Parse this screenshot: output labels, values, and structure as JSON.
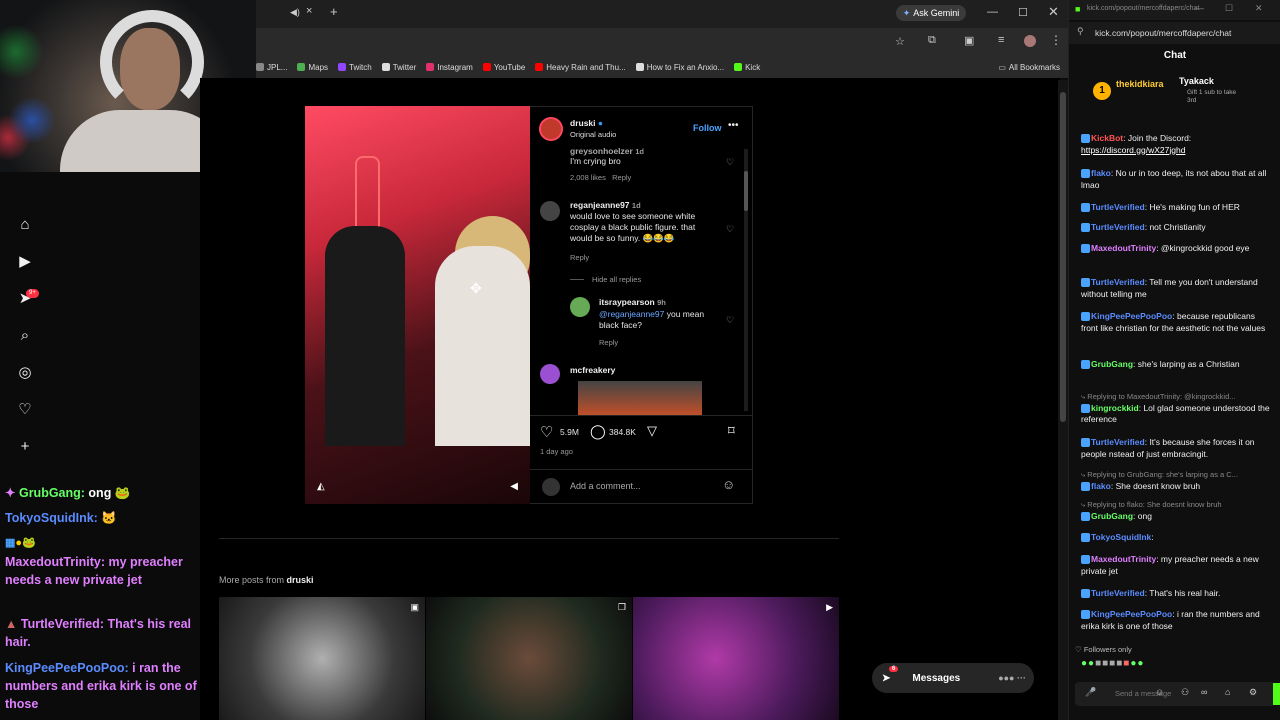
{
  "webcam": {},
  "browser": {
    "tab_icons": {
      "mute": "speaker-icon",
      "close": "×",
      "new": "+"
    },
    "gemini": "Ask Gemini",
    "bookmarks": [
      {
        "label": "JPL...",
        "color": "#888"
      },
      {
        "label": "Maps",
        "color": "#4caf50"
      },
      {
        "label": "Twitch",
        "color": "#9146ff"
      },
      {
        "label": "Twitter",
        "color": "#ddd"
      },
      {
        "label": "Instagram",
        "color": "#e1306c"
      },
      {
        "label": "YouTube",
        "color": "#ff0000"
      },
      {
        "label": "Heavy Rain and Thu...",
        "color": "#ff0000"
      },
      {
        "label": "How to Fix an Anxio...",
        "color": "#ddd"
      },
      {
        "label": "Kick",
        "color": "#53fc18"
      }
    ],
    "all_bookmarks": "All Bookmarks"
  },
  "left_chat": [
    {
      "user": "GrubGang:",
      "msg": "ong",
      "user_color": "#66ff66",
      "msg_color": "#ffffff"
    },
    {
      "user": "TokyoSquidInk:",
      "msg": "",
      "user_color": "#5b8cff",
      "msg_color": "#ffffff"
    },
    {
      "user": "MaxedoutTrinity:",
      "msg": "my preacher needs a new private jet",
      "user_color": "#e07fff",
      "msg_color": "#e07fff"
    },
    {
      "user": "TurtleVerified:",
      "msg": "That's his real hair.",
      "user_color": "#e07fff",
      "msg_color": "#e07fff"
    },
    {
      "user": "KingPeePeePooPoo:",
      "msg": "i ran the numbers and erika kirk is one of those",
      "user_color": "#5b8cff",
      "msg_color": "#e07fff"
    }
  ],
  "post": {
    "username": "druski",
    "audio": "Original audio",
    "follow": "Follow",
    "comments": [
      {
        "user": "greysonhoelzer",
        "time": "1d",
        "text": "I'm crying bro",
        "likes": "2,008 likes",
        "reply": "Reply"
      },
      {
        "user": "reganjeanne97",
        "time": "1d",
        "text": "would love to see someone white cosplay a black public figure. that would be so funny. 😂😂😂",
        "reply": "Reply"
      }
    ],
    "hide_replies": "Hide all replies",
    "nested": {
      "user": "itsraypearson",
      "time": "9h",
      "mention": "@reganjeanne97",
      "text": " you mean black face?",
      "reply": "Reply"
    },
    "last_user": "mcfreakery",
    "likes": "5.9M",
    "comment_count": "384.8K",
    "posted": "1 day ago",
    "add_comment": "Add a comment...",
    "more_posts_prefix": "More posts from ",
    "more_posts_user": "druski",
    "messages": "Messages",
    "messages_badge": "6"
  },
  "kick": {
    "url": "kick.com/popout/mercoffdaperc/chat",
    "url_display": "kick.com/popout/mercoffdaperc/chat",
    "title": "Chat",
    "pinned_user1": "thekidkiara",
    "pinned_user2": "Tyakack",
    "pinned_note": "Gift 1 sub to take 3rd",
    "messages": [
      {
        "user": "KickBot",
        "color": "#ff5555",
        "text": "Join the Discord: ",
        "link": "https://discord.gg/wX27jghd"
      },
      {
        "user": "flako",
        "color": "#5b8cff",
        "text": "No ur in too deep, its not abou that at all lmao"
      },
      {
        "user": "TurtleVerified",
        "color": "#5b8cff",
        "text": "He's making fun of HER"
      },
      {
        "user": "TurtleVerified",
        "color": "#5b8cff",
        "text": "not Christianity"
      },
      {
        "user": "MaxedoutTrinity",
        "color": "#e07fff",
        "text": "@kingrockkid good eye"
      },
      {
        "user": "TurtleVerified",
        "color": "#5b8cff",
        "text": "Tell me you don't understand without telling me"
      },
      {
        "user": "KingPeePeePooPoo",
        "color": "#5b8cff",
        "text": "because republicans front like christian for the aesthetic not the values"
      },
      {
        "user": "GrubGang",
        "color": "#66ff66",
        "text": "she's larping as a Christian"
      },
      {
        "reply": "Replying to MaxedoutTrinity: @kingrockkid...",
        "user": "kingrockkid",
        "color": "#66ff66",
        "text": "Lol glad someone understood the reference"
      },
      {
        "user": "TurtleVerified",
        "color": "#5b8cff",
        "text": "It's because she forces it on people nstead of just embracingit."
      },
      {
        "reply": "Replying to GrubGang: she's larping as a C...",
        "user": "flako",
        "color": "#5b8cff",
        "text": "She doesnt know bruh"
      },
      {
        "reply": "Replying to flako: She doesnt know bruh",
        "user": "GrubGang",
        "color": "#66ff66",
        "text": "ong"
      },
      {
        "user": "TokyoSquidInk",
        "color": "#5b8cff",
        "text": ""
      },
      {
        "user": "MaxedoutTrinity",
        "color": "#e07fff",
        "text": "my preacher needs a new private jet"
      },
      {
        "user": "TurtleVerified",
        "color": "#5b8cff",
        "text": "That's his real hair."
      },
      {
        "user": "KingPeePeePooPoo",
        "color": "#5b8cff",
        "text": "i ran the numbers and erika kirk is one of those"
      }
    ],
    "followers_only": "Followers only",
    "send_placeholder": "Send a message"
  }
}
